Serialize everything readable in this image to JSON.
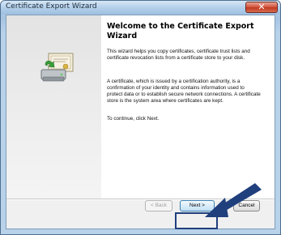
{
  "window": {
    "title": "Certificate Export Wizard",
    "close_glyph": "✕"
  },
  "wizard": {
    "heading": "Welcome to the Certificate Export Wizard",
    "paragraphs": [
      "This wizard helps you copy certificates, certificate trust lists and certificate revocation lists from a certificate store to your disk.",
      "A certificate, which is issued by a certification authority, is a confirmation of your identity and contains information used to protect data or to establish secure network connections. A certificate store is the system area where certificates are kept.",
      "To continue, click Next."
    ],
    "graphic_icon": "certificate-export-icon"
  },
  "buttons": {
    "back": "< Back",
    "next": "Next >",
    "cancel": "Cancel"
  },
  "annotation": {
    "arrow_color": "#1f3f7d",
    "highlight_target": "next-button"
  },
  "colors": {
    "title_bar": "#a6c4e2",
    "close_button": "#c0391f",
    "side_panel": "#e8e8e8"
  }
}
